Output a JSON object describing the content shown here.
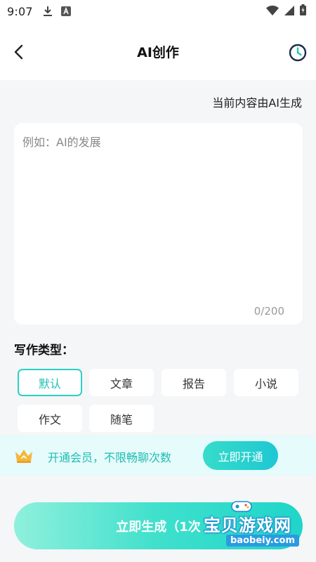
{
  "status_bar": {
    "time": "9:07",
    "left_icons": [
      "download-icon",
      "a-badge-icon"
    ],
    "right_icons": [
      "wifi-icon",
      "signal-icon",
      "battery-icon"
    ]
  },
  "nav": {
    "title": "AI创作",
    "back_icon": "chevron-left-icon",
    "history_icon": "clock-icon"
  },
  "hint": "当前内容由AI生成",
  "prompt": {
    "value": "",
    "placeholder": "例如：AI的发展",
    "char_count": "0/200"
  },
  "writing_types": {
    "label": "写作类型：",
    "options": [
      {
        "label": "默认",
        "selected": true
      },
      {
        "label": "文章",
        "selected": false
      },
      {
        "label": "报告",
        "selected": false
      },
      {
        "label": "小说",
        "selected": false
      },
      {
        "label": "作文",
        "selected": false
      },
      {
        "label": "随笔",
        "selected": false
      }
    ]
  },
  "vip_banner": {
    "icon": "crown-icon",
    "text": "开通会员，不限畅聊次数",
    "button_label": "立即开通"
  },
  "generate_button": {
    "label": "立即生成（1次"
  },
  "watermark": {
    "title": "宝贝游戏网",
    "url": "baobeiy.com"
  },
  "colors": {
    "accent": "#2bd0c4",
    "accent_text": "#1dbdb2",
    "banner_bg": "#e6fbfb",
    "page_bg": "#f4f6f8"
  }
}
